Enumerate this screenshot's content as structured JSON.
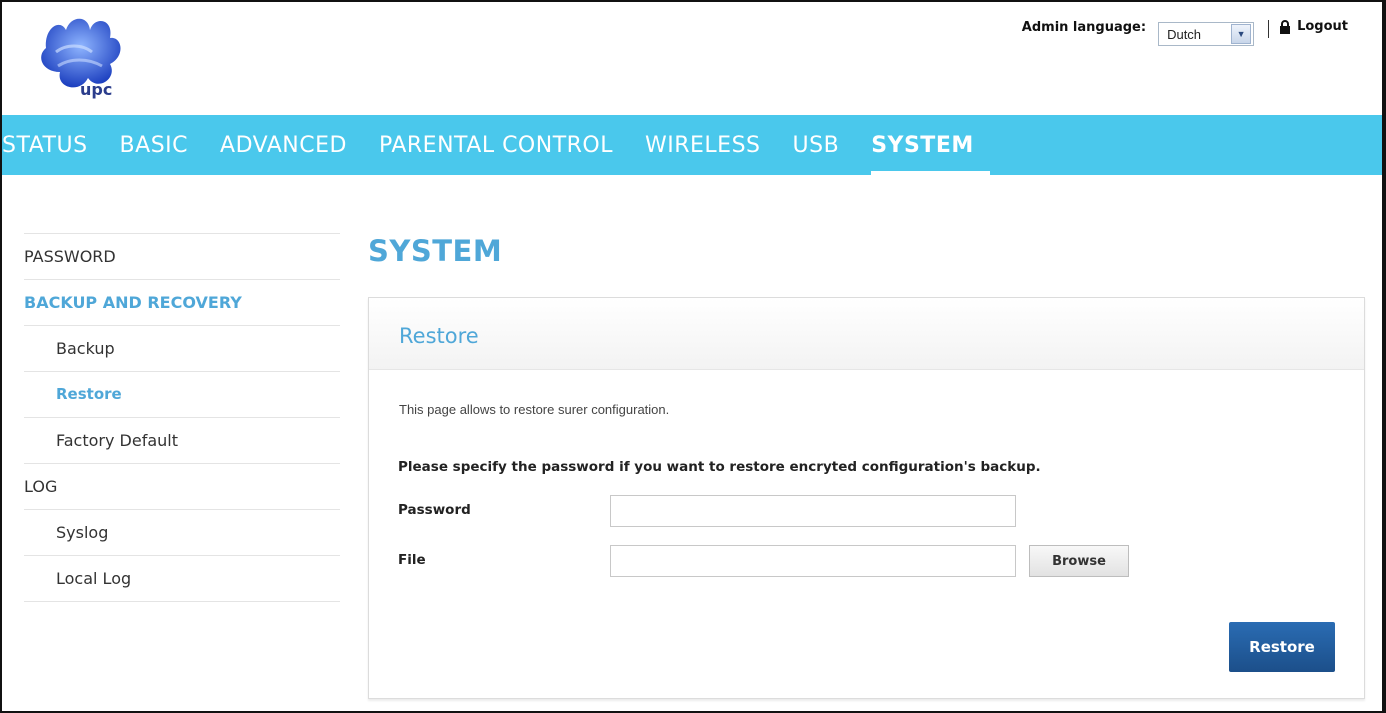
{
  "header": {
    "logo_text": "upc",
    "admin_language_label": "Admin language:",
    "language_value": "Dutch",
    "logout_label": "Logout"
  },
  "nav": {
    "items": [
      {
        "label": "STATUS",
        "active": false
      },
      {
        "label": "BASIC",
        "active": false
      },
      {
        "label": "ADVANCED",
        "active": false
      },
      {
        "label": "PARENTAL CONTROL",
        "active": false
      },
      {
        "label": "WIRELESS",
        "active": false
      },
      {
        "label": "USB",
        "active": false
      },
      {
        "label": "SYSTEM",
        "active": true
      }
    ]
  },
  "sidebar": {
    "items": [
      {
        "label": "PASSWORD"
      },
      {
        "label": "BACKUP AND RECOVERY"
      },
      {
        "label": "Backup"
      },
      {
        "label": "Restore"
      },
      {
        "label": "Factory Default"
      },
      {
        "label": "LOG"
      },
      {
        "label": "Syslog"
      },
      {
        "label": "Local Log"
      }
    ]
  },
  "main": {
    "page_title": "SYSTEM",
    "panel_title": "Restore",
    "description": "This page allows to restore surer configuration.",
    "note": "Please specify the password if you want to restore encryted configuration's backup.",
    "password_label": "Password",
    "password_value": "",
    "file_label": "File",
    "file_value": "",
    "browse_label": "Browse",
    "restore_label": "Restore"
  },
  "colors": {
    "nav_bg": "#4ac8ec",
    "accent_blue": "#4fa7d8",
    "button_blue": "#1c4f8a"
  }
}
